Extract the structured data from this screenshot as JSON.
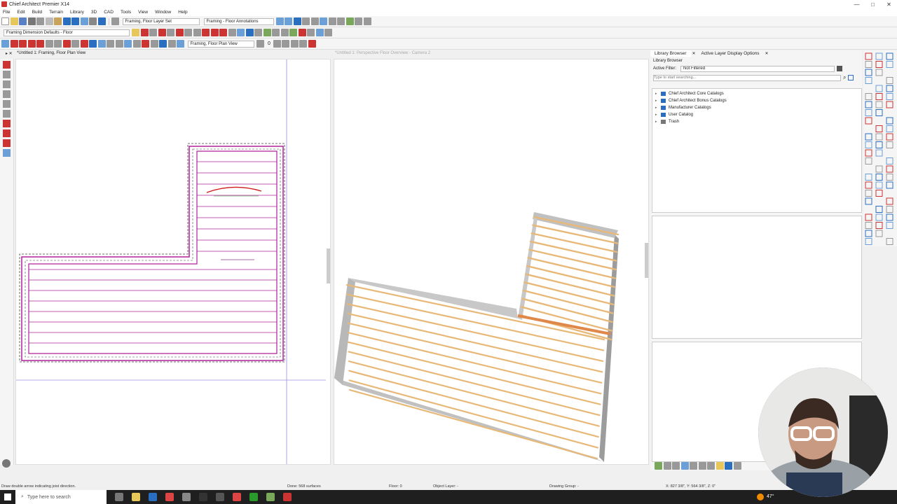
{
  "window": {
    "title": "Chief Architect Premier X14",
    "controls": [
      "—",
      "□",
      "✕"
    ]
  },
  "menu": [
    "File",
    "Edit",
    "Build",
    "Terrain",
    "Library",
    "3D",
    "CAD",
    "Tools",
    "View",
    "Window",
    "Help"
  ],
  "toolbar1": {
    "layer_set": "Framing, Floor Layer Set",
    "annotation_set": "Framing - Floor Annotations"
  },
  "toolbar2": {
    "dimension_defaults": "Framing Dimension Defaults - Floor"
  },
  "toolbar3": {
    "view_combo": "Framing, Floor Plan View",
    "floor_number": "0"
  },
  "views": {
    "plan_tab": "*Untitled 1: Framing, Floor Plan View",
    "persp_tab": "*Untitled 1: Perspective Floor Overview - Camera 2"
  },
  "library": {
    "tab_browser": "Library Browser",
    "tab_layers": "Active Layer Display Options",
    "header": "Library Browser",
    "filter_label": "Active Filter:",
    "filter_value": "Not Filtered",
    "search_placeholder": "Type to start searching...",
    "tree": [
      {
        "label": "Chief Architect Core Catalogs"
      },
      {
        "label": "Chief Architect Bonus Catalogs"
      },
      {
        "label": "Manufacturer Catalogs"
      },
      {
        "label": "User Catalog"
      },
      {
        "label": "Trash"
      }
    ]
  },
  "status": {
    "hint": "Draw double arrow indicating joist direction.",
    "done": "Done: 568 surfaces",
    "floor": "Floor: 0",
    "object_layer": "Object Layer: -",
    "drawing_group": "Drawing Group: -",
    "coords": "X: 827 3/8\", Y: 564 3/8\", Z: 0\""
  },
  "taskbar": {
    "search_placeholder": "Type here to search",
    "weather": "47°"
  },
  "colors": {
    "framing_plan": "#b0209a",
    "joist_wood": "#e8b878",
    "wall_grey": "#b8b8b8"
  }
}
